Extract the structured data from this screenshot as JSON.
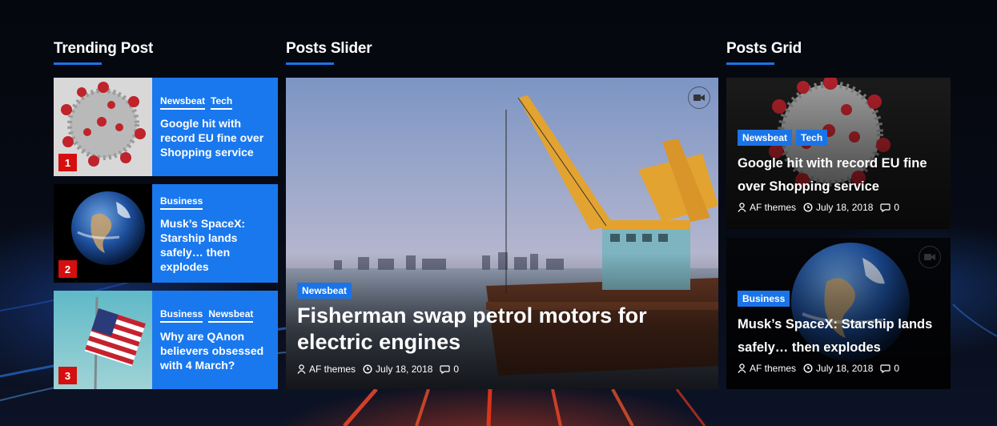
{
  "sections": {
    "trending_title": "Trending Post",
    "slider_title": "Posts Slider",
    "grid_title": "Posts Grid"
  },
  "trending": [
    {
      "rank": "1",
      "categories": [
        "Newsbeat",
        "Tech"
      ],
      "title": "Google hit with record EU fine over Shopping service",
      "thumb": "coronavirus-image"
    },
    {
      "rank": "2",
      "categories": [
        "Business"
      ],
      "title": "Musk’s SpaceX: Starship lands safely… then explodes",
      "thumb": "earth-image"
    },
    {
      "rank": "3",
      "categories": [
        "Business",
        "Newsbeat"
      ],
      "title": "Why are QAnon believers obsessed with 4 March?",
      "thumb": "us-flag-image"
    }
  ],
  "slider": {
    "category": "Newsbeat",
    "title": "Fisherman swap petrol motors for electric engines",
    "author": "AF themes",
    "date": "July 18, 2018",
    "comments": "0",
    "icon": "video-camera-icon"
  },
  "grid": [
    {
      "categories": [
        "Newsbeat",
        "Tech"
      ],
      "title": "Google hit with record EU fine over Shopping service",
      "author": "AF themes",
      "date": "July 18, 2018",
      "comments": "0"
    },
    {
      "categories": [
        "Business"
      ],
      "title": "Musk’s SpaceX: Starship lands safely… then explodes",
      "author": "AF themes",
      "date": "July 18, 2018",
      "comments": "0"
    }
  ],
  "colors": {
    "accent": "#1a74e8",
    "rank_badge": "#d50f0f",
    "card_blue": "#1a78ee"
  }
}
